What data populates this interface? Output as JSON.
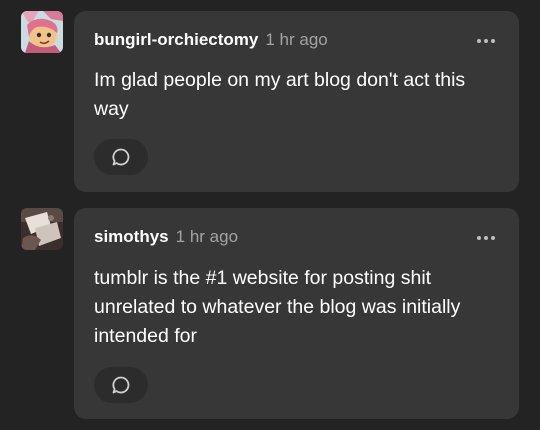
{
  "replies": [
    {
      "username": "bungirl-orchiectomy",
      "timestamp": "1 hr ago",
      "text": "Im glad people on my art blog don't act this way",
      "avatar_icon": "pink-character-avatar-icon",
      "more_icon": "more-options-icon",
      "reply_icon": "speech-bubble-icon"
    },
    {
      "username": "simothys",
      "timestamp": "1 hr ago",
      "text": "tumblr is the #1 website for posting shit unrelated to whatever the blog was initially intended for",
      "avatar_icon": "photo-avatar-icon",
      "more_icon": "more-options-icon",
      "reply_icon": "speech-bubble-icon"
    }
  ],
  "colors": {
    "background": "#232323",
    "card": "#373737",
    "timestamp": "#a3a3a3",
    "button": "#2c2c2c"
  }
}
